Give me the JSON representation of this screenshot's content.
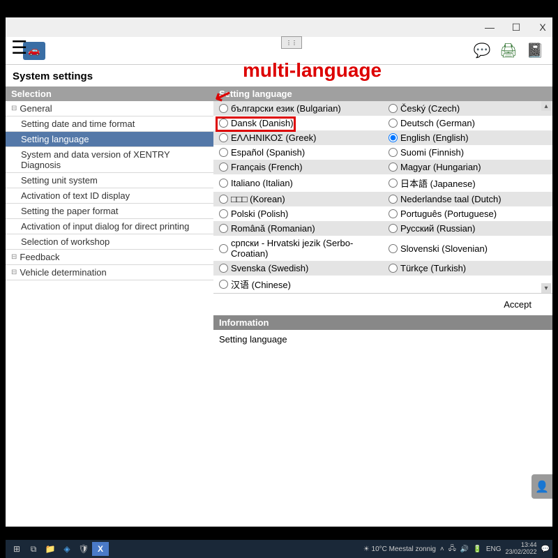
{
  "page_title": "System settings",
  "sidebar": {
    "header": "Selection",
    "groups": [
      {
        "label": "General",
        "children": [
          "Setting date and time format",
          "Setting language",
          "System and data version of XENTRY Diagnosis",
          "Setting unit system",
          "Activation of text ID display",
          "Setting the paper format",
          "Activation of input dialog for direct printing",
          "Selection of workshop"
        ],
        "selected_index": 1
      },
      {
        "label": "Feedback",
        "children": []
      },
      {
        "label": "Vehicle determination",
        "children": []
      }
    ]
  },
  "main": {
    "header": "Setting language",
    "languages": [
      [
        "български език (Bulgarian)",
        "Český (Czech)"
      ],
      [
        "Dansk (Danish)",
        "Deutsch (German)"
      ],
      [
        "ΕΛΛΗΝΙΚΟΣ (Greek)",
        "English (English)"
      ],
      [
        "Español (Spanish)",
        "Suomi (Finnish)"
      ],
      [
        "Français (French)",
        "Magyar (Hungarian)"
      ],
      [
        "Italiano (Italian)",
        "日本語 (Japanese)"
      ],
      [
        "□□□ (Korean)",
        "Nederlandse taal (Dutch)"
      ],
      [
        "Polski (Polish)",
        "Português (Portuguese)"
      ],
      [
        "Română (Romanian)",
        "Русский (Russian)"
      ],
      [
        "српски - Hrvatski jezik (Serbo-Croatian)",
        "Slovenski (Slovenian)"
      ],
      [
        "Svenska (Swedish)",
        "Türkçe (Turkish)"
      ],
      [
        "汉语 (Chinese)",
        ""
      ]
    ],
    "selected": "English (English)",
    "accept_label": "Accept",
    "info_header": "Information",
    "info_text": "Setting language"
  },
  "annotation": "multi-language",
  "taskbar": {
    "weather": "10°C  Meestal zonnig",
    "lang": "ENG",
    "time": "13:44",
    "date": "23/02/2022"
  }
}
